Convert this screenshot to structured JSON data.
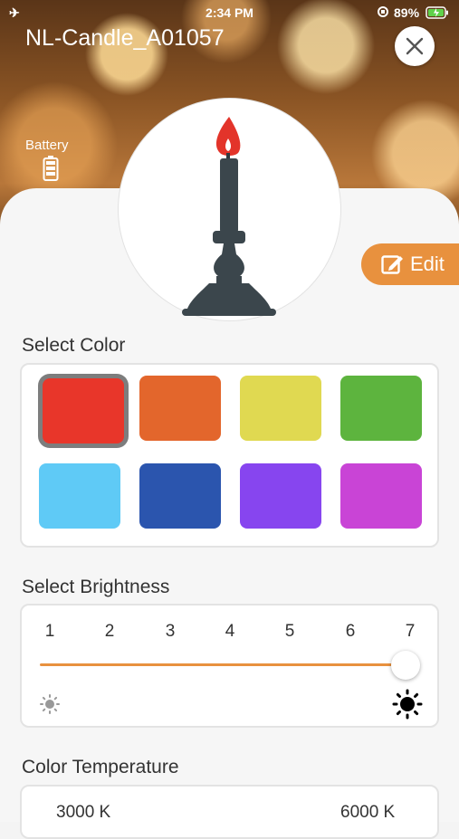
{
  "status": {
    "time": "2:34 PM",
    "battery_pct": "89%",
    "icons": [
      "airplane-icon",
      "rotation-lock-icon",
      "battery-charging-icon"
    ]
  },
  "header": {
    "title": "NL-Candle_A01057",
    "battery_label": "Battery"
  },
  "edit": {
    "label": "Edit"
  },
  "color": {
    "label": "Select Color",
    "swatches": [
      "#e8362a",
      "#e3662c",
      "#e0d951",
      "#5db43e",
      "#5fcaf6",
      "#2b55ae",
      "#8745ef",
      "#c944d6"
    ],
    "selected_index": 0
  },
  "brightness": {
    "label": "Select Brightness",
    "levels": [
      "1",
      "2",
      "3",
      "4",
      "5",
      "6",
      "7"
    ],
    "value": 7,
    "accent": "#e8913e"
  },
  "temperature": {
    "label": "Color Temperature",
    "min_label": "3000 K",
    "max_label": "6000 K"
  }
}
